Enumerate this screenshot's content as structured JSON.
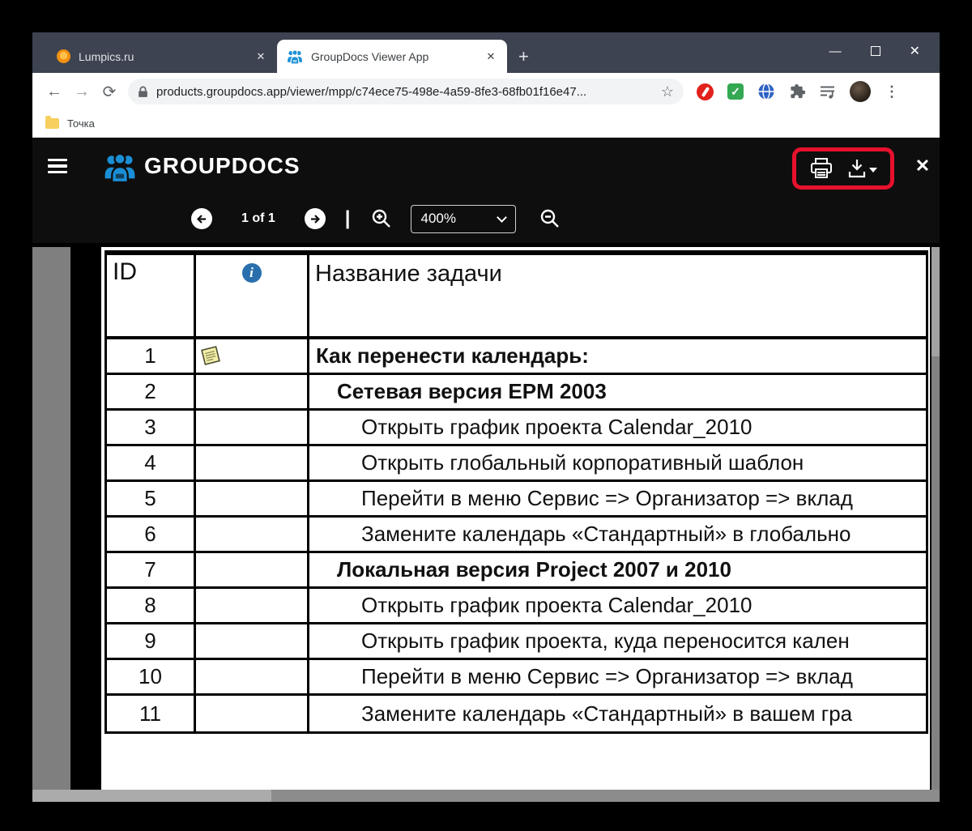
{
  "icons": {
    "tab_close": "✕",
    "new_tab": "+",
    "window_minimize": "—",
    "window_close": "✕",
    "back": "←",
    "forward": "→",
    "reload": "⟳",
    "star": "☆",
    "menu_dots": "⋮",
    "check": "✓",
    "viewer_close": "✕",
    "divider": "|",
    "info": "i"
  },
  "colors": {
    "brand_blue": "#1a8fd6",
    "highlight_red": "#e8112d",
    "info_blue": "#2a6fad",
    "tabstrip": "#3d4350"
  },
  "browser": {
    "tabs": [
      {
        "title": "Lumpics.ru"
      },
      {
        "title": "GroupDocs Viewer App"
      }
    ],
    "url": "products.groupdocs.app/viewer/mpp/c74ece75-498e-4a59-8fe3-68fb01f16e47...",
    "bookmarks": {
      "folder_label": "Точка"
    }
  },
  "viewer": {
    "brand": "GROUPDOCS",
    "page_label": "1 of 1",
    "zoom_value": "400%"
  },
  "document": {
    "header": {
      "id_label": "ID",
      "name_label": "Название задачи"
    },
    "rows": [
      {
        "id": "1",
        "note": true,
        "bold": true,
        "indent": 0,
        "text": "Как перенести календарь:"
      },
      {
        "id": "2",
        "note": false,
        "bold": true,
        "indent": 1,
        "text": "Сетевая версия EPM 2003"
      },
      {
        "id": "3",
        "note": false,
        "bold": false,
        "indent": 2,
        "text": "Открыть график проекта Calendar_2010"
      },
      {
        "id": "4",
        "note": false,
        "bold": false,
        "indent": 2,
        "text": "Открыть глобальный корпоративный шаблон"
      },
      {
        "id": "5",
        "note": false,
        "bold": false,
        "indent": 2,
        "text": "Перейти в меню Сервис => Организатор => вклад"
      },
      {
        "id": "6",
        "note": false,
        "bold": false,
        "indent": 2,
        "text": "Замените календарь «Стандартный» в глобально"
      },
      {
        "id": "7",
        "note": false,
        "bold": true,
        "indent": 1,
        "text": "Локальная версия Project 2007 и 2010"
      },
      {
        "id": "8",
        "note": false,
        "bold": false,
        "indent": 2,
        "text": "Открыть график проекта Calendar_2010"
      },
      {
        "id": "9",
        "note": false,
        "bold": false,
        "indent": 2,
        "text": "Открыть график проекта, куда переносится кален"
      },
      {
        "id": "10",
        "note": false,
        "bold": false,
        "indent": 2,
        "text": "Перейти в меню Сервис => Организатор => вклад"
      },
      {
        "id": "11",
        "note": false,
        "bold": false,
        "indent": 2,
        "text": "Замените календарь «Стандартный» в вашем гра"
      }
    ]
  }
}
